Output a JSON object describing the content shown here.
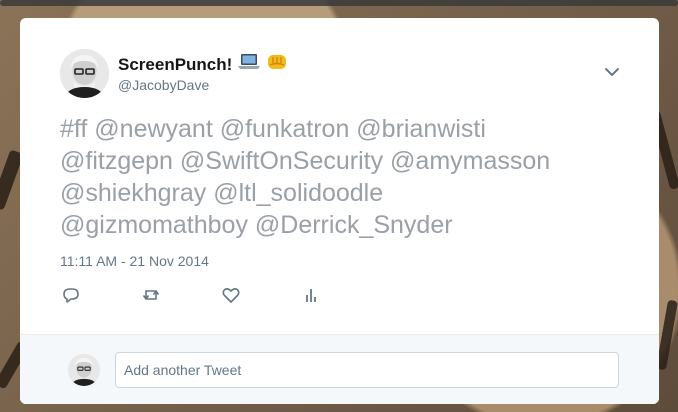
{
  "profile": {
    "display_name": "ScreenPunch!",
    "handle": "@JacobyDave",
    "emoji": [
      "laptop-icon",
      "fist-icon"
    ]
  },
  "tweet": {
    "text_lines": [
      "#ff @newyant @funkatron @brianwisti",
      "@fitzgepn @SwiftOnSecurity @amymasson",
      "@shiekhgray @ltl_solidoodle",
      "@gizmomathboy @Derrick_Snyder"
    ],
    "timestamp": "11:11 AM - 21 Nov 2014"
  },
  "actions": [
    "reply-icon",
    "retweet-icon",
    "like-icon",
    "analytics-icon"
  ],
  "reply": {
    "placeholder": "Add another Tweet"
  },
  "colors": {
    "link_text": "#9aa0a6",
    "meta": "#657786",
    "reply_bar": "#f5f8fa"
  }
}
